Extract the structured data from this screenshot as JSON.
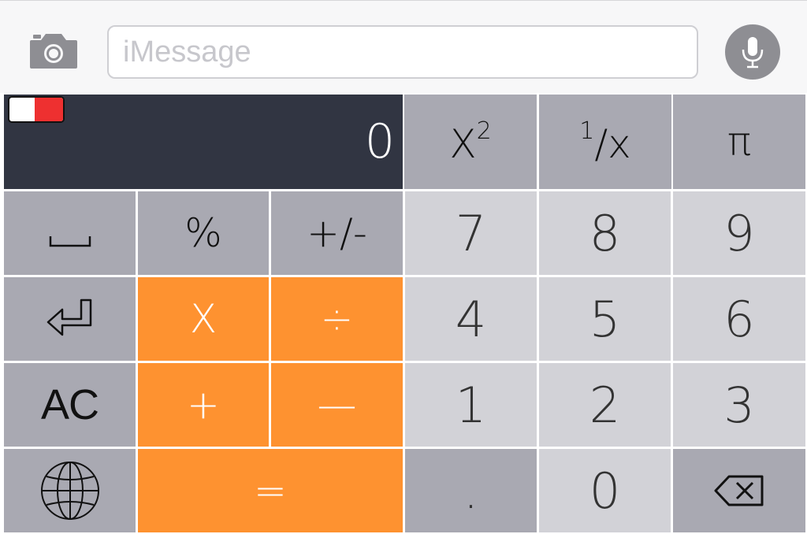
{
  "message_bar": {
    "placeholder": "iMessage",
    "camera_icon": "camera-icon",
    "mic_icon": "microphone-icon"
  },
  "display": {
    "value": "0",
    "toggle_colors": [
      "#ffffff",
      "#ee3030"
    ]
  },
  "keys": {
    "square": "X",
    "square_sup": "2",
    "reciprocal_sup": "1",
    "reciprocal_main": "/x",
    "pi": "π",
    "space_icon": "space-icon",
    "percent": "%",
    "plus_minus": "+/-",
    "seven": "7",
    "eight": "8",
    "nine": "9",
    "return_icon": "return-icon",
    "multiply": "X",
    "divide": "÷",
    "four": "4",
    "five": "5",
    "six": "6",
    "ac": "AC",
    "plus": "+",
    "minus": "—",
    "one": "1",
    "two": "2",
    "three": "3",
    "globe_icon": "globe-icon",
    "equals": "=",
    "decimal": ".",
    "zero": "0",
    "backspace_icon": "backspace-icon"
  },
  "colors": {
    "display_bg": "#313542",
    "function_key": "#a9a9b2",
    "number_key": "#d2d2d7",
    "operator_key": "#fe9230"
  }
}
